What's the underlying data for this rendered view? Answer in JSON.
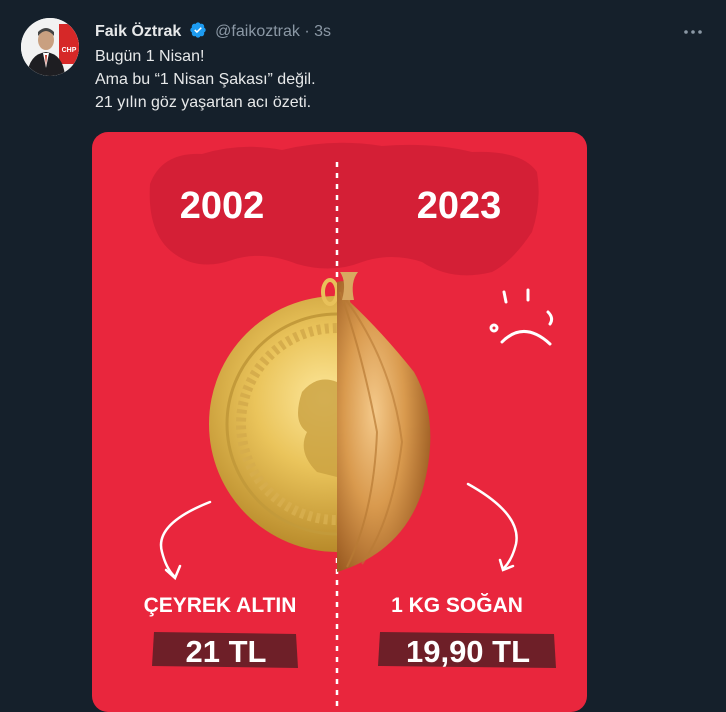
{
  "author": {
    "name": "Faik Öztrak",
    "handle": "@faikoztrak",
    "separator": "·",
    "time": "3s",
    "avatar_badge": "CHP"
  },
  "tweet": {
    "lines": [
      "Bugün 1 Nisan!",
      "Ama bu “1 Nisan Şakası” değil.",
      "21 yılın göz yaşartan acı özeti."
    ]
  },
  "infographic": {
    "year_left": "2002",
    "year_right": "2023",
    "label_left": "ÇEYREK ALTIN",
    "label_right": "1 KG SOĞAN",
    "price_left": "21 TL",
    "price_right": "19,90 TL"
  },
  "colors": {
    "background": "#15202b",
    "card_red": "#e9263d",
    "verified_blue": "#1d9bf0",
    "price_bg": "#6e1f28"
  },
  "icons": {
    "verified": "verified-badge-icon",
    "more": "more-horizontal-icon",
    "sad_face": "sad-face-icon",
    "arrows": "curved-arrow-icon"
  }
}
